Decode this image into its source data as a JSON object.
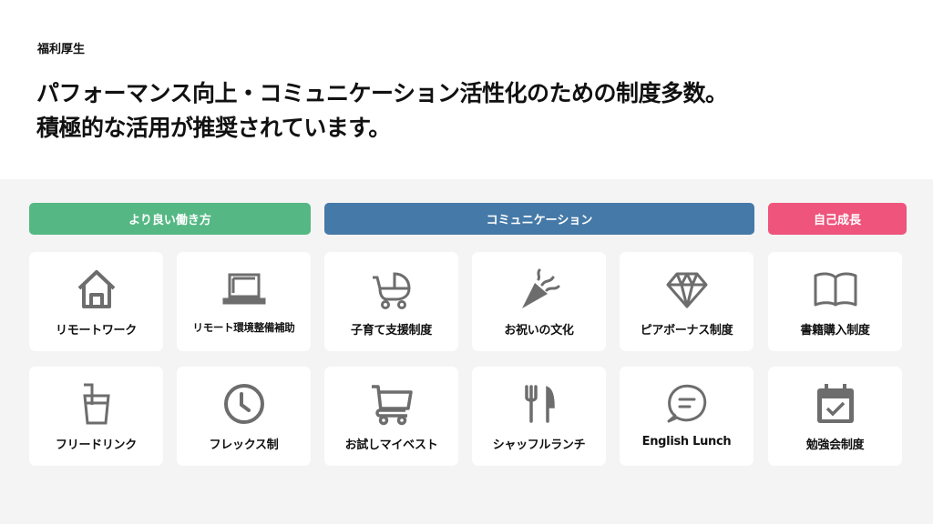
{
  "header": {
    "eyebrow": "福利厚生",
    "headline_line1": "パフォーマンス向上・コミュニケーション活性化のための制度多数。",
    "headline_line2": "積極的な活用が推奨されています。"
  },
  "categories": [
    {
      "label": "より良い働き方",
      "color": "#55b884"
    },
    {
      "label": "コミュニケーション",
      "color": "#4579a7"
    },
    {
      "label": "自己成長",
      "color": "#ee547c"
    }
  ],
  "benefits": [
    {
      "label": "リモートワーク",
      "icon": "house-icon"
    },
    {
      "label": "リモート環境整備補助",
      "icon": "laptop-icon"
    },
    {
      "label": "子育て支援制度",
      "icon": "baby-stroller-icon"
    },
    {
      "label": "お祝いの文化",
      "icon": "party-popper-icon"
    },
    {
      "label": "ピアボーナス制度",
      "icon": "diamond-icon"
    },
    {
      "label": "書籍購入制度",
      "icon": "open-book-icon"
    },
    {
      "label": "フリードリンク",
      "icon": "drink-cup-icon"
    },
    {
      "label": "フレックス制",
      "icon": "clock-icon"
    },
    {
      "label": "お試しマイベスト",
      "icon": "shopping-cart-icon"
    },
    {
      "label": "シャッフルランチ",
      "icon": "fork-knife-icon"
    },
    {
      "label": "English Lunch",
      "icon": "chat-bubble-icon"
    },
    {
      "label": "勉強会制度",
      "icon": "calendar-check-icon"
    }
  ],
  "colors": {
    "icon": "#6d6d6d",
    "background": "#f4f4f4"
  }
}
